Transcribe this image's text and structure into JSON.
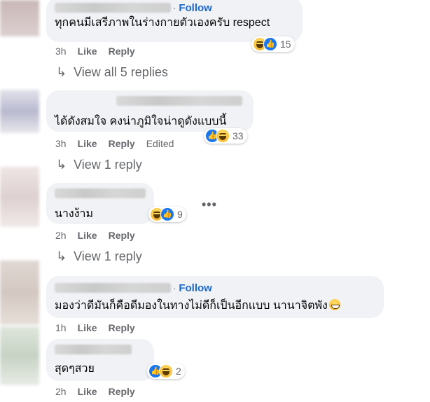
{
  "comments": [
    {
      "follow": "Follow",
      "text": "ทุกคนมีเสรีภาพในร่างกายตัวเองครับ respect",
      "time": "3h",
      "like": "Like",
      "reply": "Reply",
      "reaction_count": "15",
      "reactions": [
        "haha-icon",
        "like-icon"
      ]
    },
    {
      "text": "ได้ดังสมใจ คงน่าภูมิใจน่าดูดังแบบนี้",
      "time": "3h",
      "like": "Like",
      "reply": "Reply",
      "edited": "Edited",
      "reaction_count": "33",
      "reactions": [
        "like-icon",
        "haha-icon"
      ]
    },
    {
      "text": "นางง้าม",
      "time": "2h",
      "like": "Like",
      "reply": "Reply",
      "reaction_count": "9",
      "reactions": [
        "haha-icon",
        "like-icon"
      ]
    },
    {
      "follow": "Follow",
      "text": "มองว่าดีมันก็คือดีมองในทางไม่ดีก็เป็นอีกแบบ นานาจิตพัง",
      "time": "1h",
      "like": "Like",
      "reply": "Reply"
    },
    {
      "text": "สุดๆสวย",
      "time": "2h",
      "like": "Like",
      "reply": "Reply",
      "reaction_count": "2",
      "reactions": [
        "like-icon",
        "haha-icon"
      ]
    }
  ],
  "reply_links": [
    "View all 5 replies",
    "View 1 reply",
    "View 1 reply"
  ],
  "more_menu": "•••",
  "colors": {
    "bubble": "#f0f2f5",
    "link": "#1d67c9",
    "meta": "#65676b",
    "like_blue": "#1877f2"
  }
}
